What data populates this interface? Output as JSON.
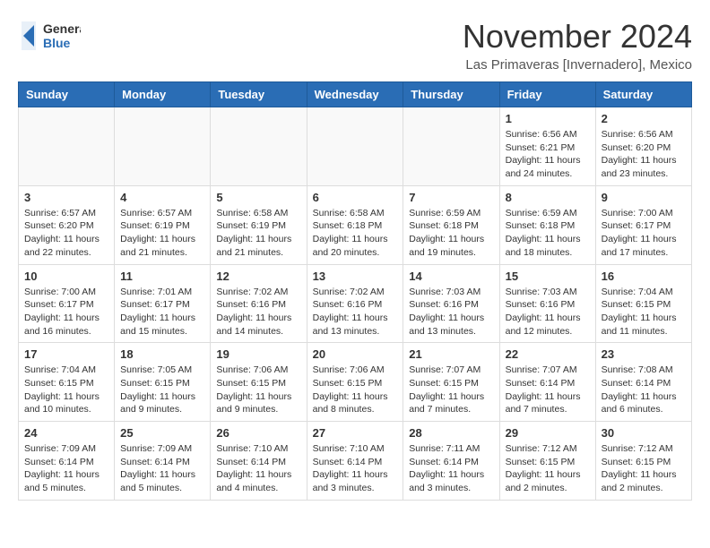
{
  "logo": {
    "line1": "General",
    "line2": "Blue"
  },
  "title": "November 2024",
  "location": "Las Primaveras [Invernadero], Mexico",
  "days_of_week": [
    "Sunday",
    "Monday",
    "Tuesday",
    "Wednesday",
    "Thursday",
    "Friday",
    "Saturday"
  ],
  "weeks": [
    [
      {
        "day": "",
        "info": ""
      },
      {
        "day": "",
        "info": ""
      },
      {
        "day": "",
        "info": ""
      },
      {
        "day": "",
        "info": ""
      },
      {
        "day": "",
        "info": ""
      },
      {
        "day": "1",
        "info": "Sunrise: 6:56 AM\nSunset: 6:21 PM\nDaylight: 11 hours and 24 minutes."
      },
      {
        "day": "2",
        "info": "Sunrise: 6:56 AM\nSunset: 6:20 PM\nDaylight: 11 hours and 23 minutes."
      }
    ],
    [
      {
        "day": "3",
        "info": "Sunrise: 6:57 AM\nSunset: 6:20 PM\nDaylight: 11 hours and 22 minutes."
      },
      {
        "day": "4",
        "info": "Sunrise: 6:57 AM\nSunset: 6:19 PM\nDaylight: 11 hours and 21 minutes."
      },
      {
        "day": "5",
        "info": "Sunrise: 6:58 AM\nSunset: 6:19 PM\nDaylight: 11 hours and 21 minutes."
      },
      {
        "day": "6",
        "info": "Sunrise: 6:58 AM\nSunset: 6:18 PM\nDaylight: 11 hours and 20 minutes."
      },
      {
        "day": "7",
        "info": "Sunrise: 6:59 AM\nSunset: 6:18 PM\nDaylight: 11 hours and 19 minutes."
      },
      {
        "day": "8",
        "info": "Sunrise: 6:59 AM\nSunset: 6:18 PM\nDaylight: 11 hours and 18 minutes."
      },
      {
        "day": "9",
        "info": "Sunrise: 7:00 AM\nSunset: 6:17 PM\nDaylight: 11 hours and 17 minutes."
      }
    ],
    [
      {
        "day": "10",
        "info": "Sunrise: 7:00 AM\nSunset: 6:17 PM\nDaylight: 11 hours and 16 minutes."
      },
      {
        "day": "11",
        "info": "Sunrise: 7:01 AM\nSunset: 6:17 PM\nDaylight: 11 hours and 15 minutes."
      },
      {
        "day": "12",
        "info": "Sunrise: 7:02 AM\nSunset: 6:16 PM\nDaylight: 11 hours and 14 minutes."
      },
      {
        "day": "13",
        "info": "Sunrise: 7:02 AM\nSunset: 6:16 PM\nDaylight: 11 hours and 13 minutes."
      },
      {
        "day": "14",
        "info": "Sunrise: 7:03 AM\nSunset: 6:16 PM\nDaylight: 11 hours and 13 minutes."
      },
      {
        "day": "15",
        "info": "Sunrise: 7:03 AM\nSunset: 6:16 PM\nDaylight: 11 hours and 12 minutes."
      },
      {
        "day": "16",
        "info": "Sunrise: 7:04 AM\nSunset: 6:15 PM\nDaylight: 11 hours and 11 minutes."
      }
    ],
    [
      {
        "day": "17",
        "info": "Sunrise: 7:04 AM\nSunset: 6:15 PM\nDaylight: 11 hours and 10 minutes."
      },
      {
        "day": "18",
        "info": "Sunrise: 7:05 AM\nSunset: 6:15 PM\nDaylight: 11 hours and 9 minutes."
      },
      {
        "day": "19",
        "info": "Sunrise: 7:06 AM\nSunset: 6:15 PM\nDaylight: 11 hours and 9 minutes."
      },
      {
        "day": "20",
        "info": "Sunrise: 7:06 AM\nSunset: 6:15 PM\nDaylight: 11 hours and 8 minutes."
      },
      {
        "day": "21",
        "info": "Sunrise: 7:07 AM\nSunset: 6:15 PM\nDaylight: 11 hours and 7 minutes."
      },
      {
        "day": "22",
        "info": "Sunrise: 7:07 AM\nSunset: 6:14 PM\nDaylight: 11 hours and 7 minutes."
      },
      {
        "day": "23",
        "info": "Sunrise: 7:08 AM\nSunset: 6:14 PM\nDaylight: 11 hours and 6 minutes."
      }
    ],
    [
      {
        "day": "24",
        "info": "Sunrise: 7:09 AM\nSunset: 6:14 PM\nDaylight: 11 hours and 5 minutes."
      },
      {
        "day": "25",
        "info": "Sunrise: 7:09 AM\nSunset: 6:14 PM\nDaylight: 11 hours and 5 minutes."
      },
      {
        "day": "26",
        "info": "Sunrise: 7:10 AM\nSunset: 6:14 PM\nDaylight: 11 hours and 4 minutes."
      },
      {
        "day": "27",
        "info": "Sunrise: 7:10 AM\nSunset: 6:14 PM\nDaylight: 11 hours and 3 minutes."
      },
      {
        "day": "28",
        "info": "Sunrise: 7:11 AM\nSunset: 6:14 PM\nDaylight: 11 hours and 3 minutes."
      },
      {
        "day": "29",
        "info": "Sunrise: 7:12 AM\nSunset: 6:15 PM\nDaylight: 11 hours and 2 minutes."
      },
      {
        "day": "30",
        "info": "Sunrise: 7:12 AM\nSunset: 6:15 PM\nDaylight: 11 hours and 2 minutes."
      }
    ]
  ]
}
